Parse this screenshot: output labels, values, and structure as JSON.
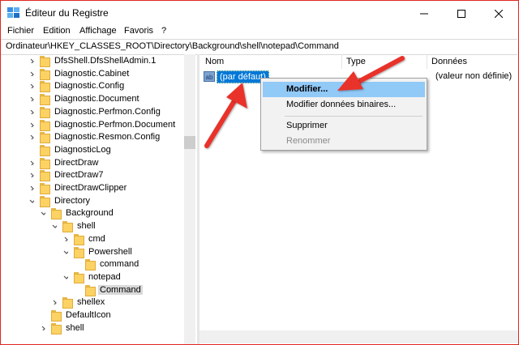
{
  "window": {
    "title": "Éditeur du Registre",
    "minimize_glyph": "—",
    "maximize_glyph": "☐",
    "close_glyph": "✕"
  },
  "menu": [
    "Fichier",
    "Edition",
    "Affichage",
    "Favoris",
    "?"
  ],
  "address": "Ordinateur\\HKEY_CLASSES_ROOT\\Directory\\Background\\shell\\notepad\\Command",
  "tree": [
    {
      "label": "DfsShell.DfsShellAdmin.1",
      "level": 0,
      "expand": "collapsed"
    },
    {
      "label": "Diagnostic.Cabinet",
      "level": 0,
      "expand": "collapsed"
    },
    {
      "label": "Diagnostic.Config",
      "level": 0,
      "expand": "collapsed"
    },
    {
      "label": "Diagnostic.Document",
      "level": 0,
      "expand": "collapsed"
    },
    {
      "label": "Diagnostic.Perfmon.Config",
      "level": 0,
      "expand": "collapsed"
    },
    {
      "label": "Diagnostic.Perfmon.Document",
      "level": 0,
      "expand": "collapsed"
    },
    {
      "label": "Diagnostic.Resmon.Config",
      "level": 0,
      "expand": "collapsed"
    },
    {
      "label": "DiagnosticLog",
      "level": 0,
      "expand": "none"
    },
    {
      "label": "DirectDraw",
      "level": 0,
      "expand": "collapsed"
    },
    {
      "label": "DirectDraw7",
      "level": 0,
      "expand": "collapsed"
    },
    {
      "label": "DirectDrawClipper",
      "level": 0,
      "expand": "collapsed"
    },
    {
      "label": "Directory",
      "level": 0,
      "expand": "expanded"
    },
    {
      "label": "Background",
      "level": 1,
      "expand": "expanded"
    },
    {
      "label": "shell",
      "level": 2,
      "expand": "expanded"
    },
    {
      "label": "cmd",
      "level": 3,
      "expand": "collapsed"
    },
    {
      "label": "Powershell",
      "level": 3,
      "expand": "expanded"
    },
    {
      "label": "command",
      "level": 4,
      "expand": "none"
    },
    {
      "label": "notepad",
      "level": 3,
      "expand": "expanded"
    },
    {
      "label": "Command",
      "level": 4,
      "expand": "none",
      "selected": true
    },
    {
      "label": "shellex",
      "level": 2,
      "expand": "collapsed"
    },
    {
      "label": "DefaultIcon",
      "level": 1,
      "expand": "none"
    },
    {
      "label": "shell",
      "level": 1,
      "expand": "collapsed"
    }
  ],
  "columns": {
    "name": "Nom",
    "type": "Type",
    "data": "Données"
  },
  "value_row": {
    "icon_text": "ab",
    "name": "(par défaut)",
    "data": "(valeur non définie)"
  },
  "context_menu": {
    "modify": "Modifier...",
    "modify_binary": "Modifier données binaires...",
    "delete": "Supprimer",
    "rename": "Renommer"
  },
  "colors": {
    "accent": "#0078d7",
    "highlight": "#91c9f7",
    "arrow": "#e8312a",
    "border": "#e0271e"
  }
}
